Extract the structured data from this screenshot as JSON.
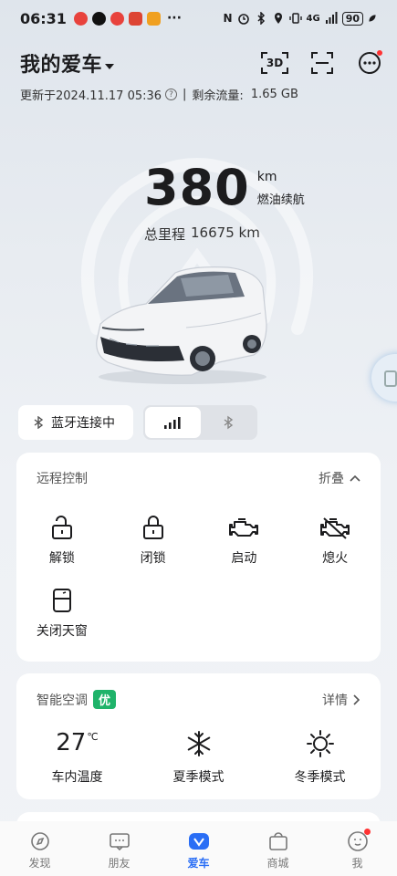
{
  "status_bar": {
    "time": "06:31",
    "battery": "90",
    "network": "4G",
    "more": "···"
  },
  "header": {
    "title": "我的爱车",
    "btn_3d": "3D"
  },
  "update": {
    "prefix": "更新于2024.11.17 05:36",
    "separator": "|",
    "data_label": "剩余流量:",
    "data_value": "1.65 GB"
  },
  "vehicle": {
    "range_value": "380",
    "range_unit": "km",
    "range_label": "燃油续航",
    "mileage_label": "总里程",
    "mileage_value": "16675 km"
  },
  "connection": {
    "bt_label": "蓝牙连接中",
    "segments": [
      "signal",
      "bluetooth"
    ],
    "active_segment": "signal"
  },
  "remote_control": {
    "title": "远程控制",
    "collapse_label": "折叠",
    "items": [
      {
        "label": "解锁",
        "icon": "unlock-icon"
      },
      {
        "label": "闭锁",
        "icon": "lock-icon"
      },
      {
        "label": "启动",
        "icon": "engine-icon"
      },
      {
        "label": "熄火",
        "icon": "engine-off-icon"
      },
      {
        "label": "关闭天窗",
        "icon": "sunroof-icon"
      }
    ]
  },
  "ac": {
    "title": "智能空调",
    "badge": "优",
    "details_label": "详情",
    "temp_value": "27",
    "temp_unit": "℃",
    "items": [
      {
        "label": "车内温度"
      },
      {
        "label": "夏季模式",
        "icon": "snowflake-icon"
      },
      {
        "label": "冬季模式",
        "icon": "sun-icon"
      }
    ]
  },
  "tabbar": {
    "tabs": [
      {
        "label": "发现",
        "icon": "compass-icon"
      },
      {
        "label": "朋友",
        "icon": "chat-icon"
      },
      {
        "label": "爱车",
        "icon": "car-logo-icon",
        "active": true
      },
      {
        "label": "商城",
        "icon": "shopping-bag-icon"
      },
      {
        "label": "我",
        "icon": "profile-icon"
      }
    ]
  },
  "colors": {
    "accent": "#2a6ef5",
    "badge_green": "#1fb36a",
    "notification_red": "#ff3333"
  }
}
